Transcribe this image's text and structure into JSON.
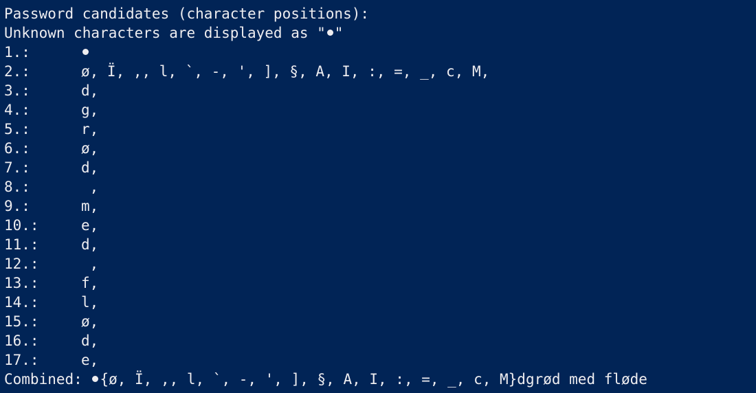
{
  "colors": {
    "background": "#012456",
    "text": "#eeedf0"
  },
  "console": {
    "header": "Password candidates (character positions):",
    "subheader_prefix": "Unknown characters are displayed as \"",
    "subheader_suffix": "\"",
    "positions": [
      {
        "index": "1.:",
        "value": "●"
      },
      {
        "index": "2.:",
        "value": "ø, Ï, ,, l, `, -, ', ], §, A, I, :, =, _, c, M,"
      },
      {
        "index": "3.:",
        "value": "d,"
      },
      {
        "index": "4.:",
        "value": "g,"
      },
      {
        "index": "5.:",
        "value": "r,"
      },
      {
        "index": "6.:",
        "value": "ø,"
      },
      {
        "index": "7.:",
        "value": "d,"
      },
      {
        "index": "8.:",
        "value": " ,"
      },
      {
        "index": "9.:",
        "value": "m,"
      },
      {
        "index": "10.:",
        "value": "e,"
      },
      {
        "index": "11.:",
        "value": "d,"
      },
      {
        "index": "12.:",
        "value": " ,"
      },
      {
        "index": "13.:",
        "value": "f,"
      },
      {
        "index": "14.:",
        "value": "l,"
      },
      {
        "index": "15.:",
        "value": "ø,"
      },
      {
        "index": "16.:",
        "value": "d,"
      },
      {
        "index": "17.:",
        "value": "e,"
      }
    ],
    "combined_label": "Combined: ",
    "combined_value": "{ø, Ï, ,, l, `, -, ', ], §, A, I, :, =, _, c, M}dgrød med fløde"
  }
}
